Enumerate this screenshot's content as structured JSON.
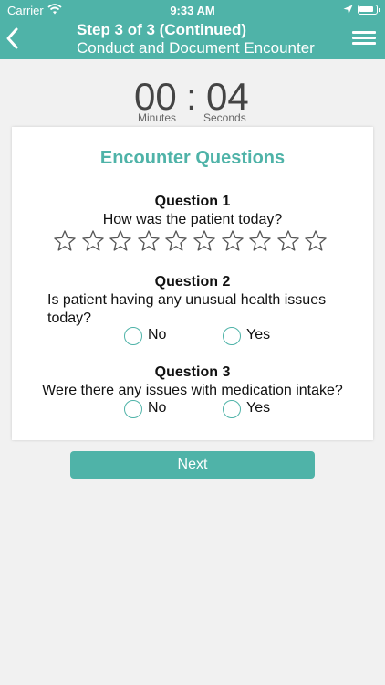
{
  "status": {
    "carrier": "Carrier",
    "time": "9:33 AM"
  },
  "header": {
    "step": "Step 3 of 3 (Continued)",
    "subtitle": "Conduct and Document Encounter"
  },
  "timer": {
    "minutes": "00",
    "separator": ":",
    "seconds": "04",
    "minutes_label": "Minutes",
    "seconds_label": "Seconds"
  },
  "card": {
    "title": "Encounter Questions",
    "q1": {
      "title": "Question 1",
      "text": "How was the patient today?",
      "rating": 0,
      "max_rating": 10
    },
    "q2": {
      "title": "Question 2",
      "text": "Is patient having any unusual health issues today?",
      "options": [
        "No",
        "Yes"
      ],
      "selected": null
    },
    "q3": {
      "title": "Question 3",
      "text": "Were there any issues with medication intake?",
      "options": [
        "No",
        "Yes"
      ],
      "selected": null
    }
  },
  "next_label": "Next",
  "colors": {
    "accent": "#4fb3a8",
    "background": "#f1f1f1"
  }
}
